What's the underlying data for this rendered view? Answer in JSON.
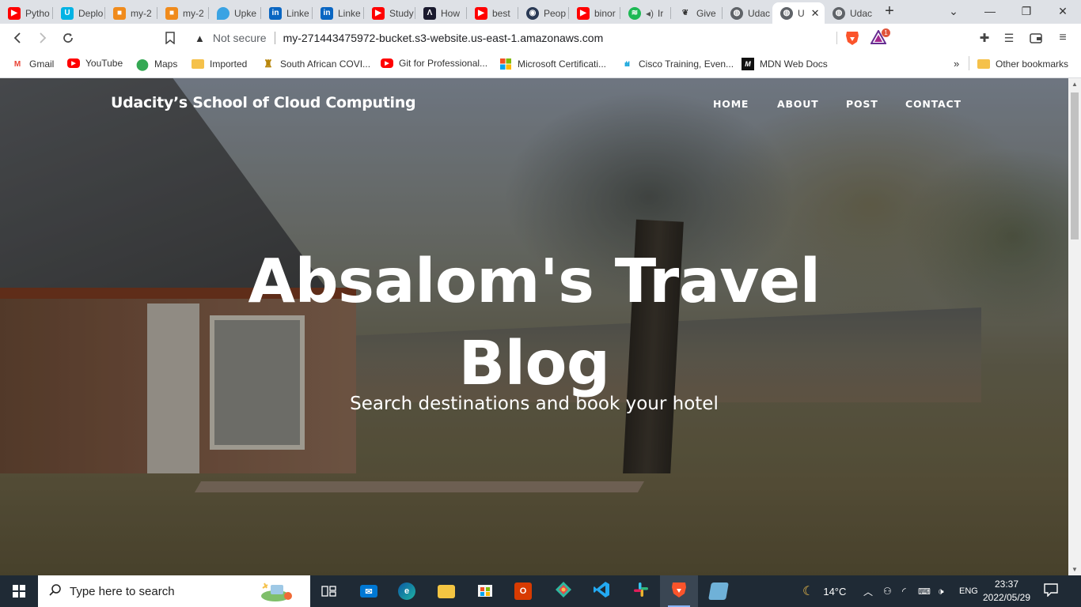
{
  "tabs": [
    {
      "title": "Pytho",
      "icon": "youtube-icon",
      "color": "#ff0000"
    },
    {
      "title": "Deplo",
      "icon": "udacity-icon",
      "color": "#02b3e4"
    },
    {
      "title": "my-2",
      "icon": "aws-box-icon",
      "color": "#f08b1c"
    },
    {
      "title": "my-2",
      "icon": "aws-box-icon",
      "color": "#f08b1c"
    },
    {
      "title": "Upke",
      "icon": "upkeep-icon",
      "color": "#3aa3e3"
    },
    {
      "title": "Linke",
      "icon": "linkedin-icon",
      "color": "#0a66c2"
    },
    {
      "title": "Linke",
      "icon": "linkedin-icon",
      "color": "#0a66c2"
    },
    {
      "title": "Study",
      "icon": "youtube-icon",
      "color": "#ff0000"
    },
    {
      "title": "How",
      "icon": "medium-icon",
      "color": "#1a1a2e"
    },
    {
      "title": "best",
      "icon": "youtube-icon",
      "color": "#ff0000"
    },
    {
      "title": "Peop",
      "icon": "eye-icon",
      "color": "#2b3a55"
    },
    {
      "title": "binor",
      "icon": "youtube-icon",
      "color": "#ff0000"
    },
    {
      "title": "Ir",
      "icon": "spotify-icon",
      "color": "#1db954"
    },
    {
      "title": "Give",
      "icon": "sprout-icon",
      "color": "#333333"
    },
    {
      "title": "Udac",
      "icon": "globe-icon",
      "color": "#5f6368"
    },
    {
      "title": "U",
      "icon": "globe-icon",
      "color": "#5f6368"
    },
    {
      "title": "Udac",
      "icon": "globe-icon",
      "color": "#5f6368"
    }
  ],
  "address_bar": {
    "security_label": "Not secure",
    "url": "my-271443475972-bucket.s3-website.us-east-1.amazonaws.com",
    "rewards_badge": "1"
  },
  "bookmarks": [
    {
      "label": "Gmail",
      "icon": "gmail-icon"
    },
    {
      "label": "YouTube",
      "icon": "youtube-icon"
    },
    {
      "label": "Maps",
      "icon": "maps-icon"
    },
    {
      "label": "Imported",
      "icon": "folder-icon"
    },
    {
      "label": "South African COVI...",
      "icon": "sa-coat-of-arms-icon"
    },
    {
      "label": "Git for Professional...",
      "icon": "youtube-icon"
    },
    {
      "label": "Microsoft Certificati...",
      "icon": "microsoft-icon"
    },
    {
      "label": "Cisco Training, Even...",
      "icon": "cisco-icon"
    },
    {
      "label": "MDN Web Docs",
      "icon": "mdn-icon"
    }
  ],
  "other_bookmarks": "Other bookmarks",
  "overflow_label": "»",
  "site": {
    "brand": "Udacity’s School of Cloud Computing",
    "nav": [
      "HOME",
      "ABOUT",
      "POST",
      "CONTACT"
    ],
    "hero_title_line1": "Absalom's Travel",
    "hero_title_line2": "Blog",
    "hero_subtitle": "Search destinations and book your hotel"
  },
  "taskbar": {
    "search_placeholder": "Type here to search",
    "apps": [
      "task-view",
      "mail",
      "edge",
      "file-explorer",
      "microsoft-store",
      "office",
      "git-kraken",
      "vscode",
      "slack",
      "brave",
      "notepad"
    ],
    "weather": "14°C",
    "language": "ENG",
    "time": "23:37",
    "date": "2022/05/29"
  }
}
